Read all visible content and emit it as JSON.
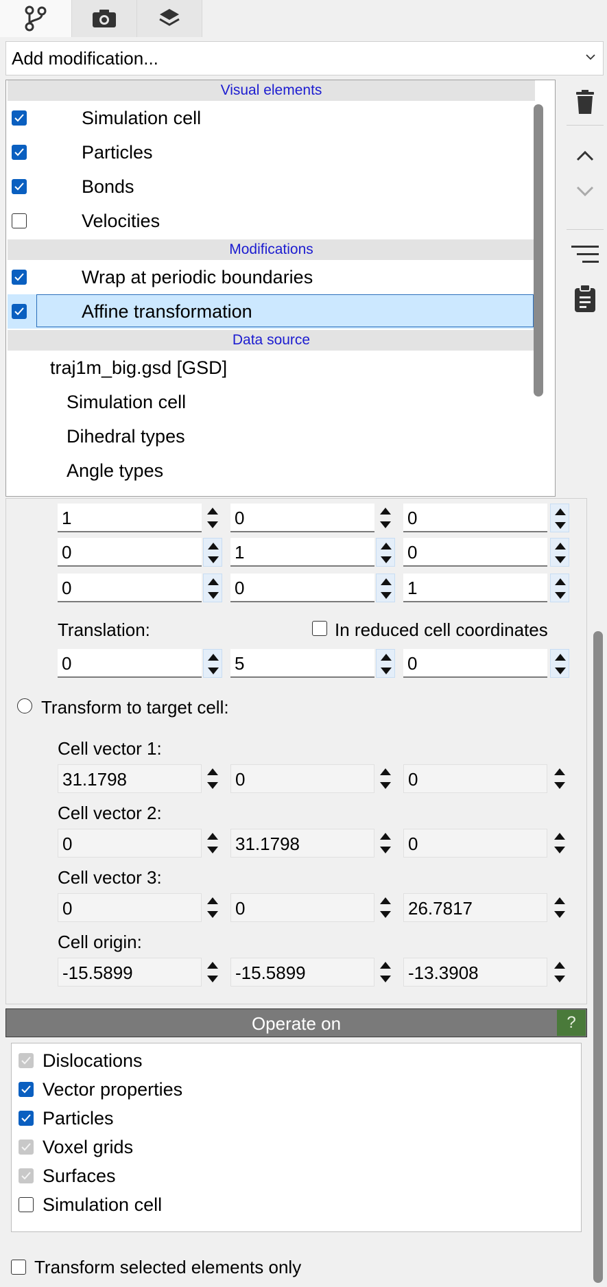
{
  "tabs": [
    {
      "name": "pipeline-tab",
      "icon": "pipeline-branch-icon"
    },
    {
      "name": "render-tab",
      "icon": "camera-icon"
    },
    {
      "name": "overlays-tab",
      "icon": "layers-icon"
    }
  ],
  "add_modification": {
    "label": "Add modification..."
  },
  "pipeline": {
    "visual_header": "Visual elements",
    "visual": [
      {
        "label": "Simulation cell",
        "checked": true
      },
      {
        "label": "Particles",
        "checked": true
      },
      {
        "label": "Bonds",
        "checked": true
      },
      {
        "label": "Velocities",
        "checked": false
      }
    ],
    "mod_header": "Modifications",
    "mods": [
      {
        "label": "Wrap at periodic boundaries",
        "checked": true
      },
      {
        "label": "Affine transformation",
        "checked": true,
        "selected": true
      }
    ],
    "ds_header": "Data source",
    "source": {
      "file": "traj1m_big.gsd [GSD]",
      "children": [
        "Simulation cell",
        "Dihedral types",
        "Angle types"
      ]
    }
  },
  "side_buttons": [
    "delete-icon",
    "move-up-icon",
    "move-down-icon",
    "manage-modifiers-icon",
    "clipboard-icon"
  ],
  "affine": {
    "matrix": [
      [
        "1",
        "0",
        "0"
      ],
      [
        "0",
        "1",
        "0"
      ],
      [
        "0",
        "0",
        "1"
      ]
    ],
    "translation_label": "Translation:",
    "reduced_label": "In reduced cell coordinates",
    "translation": [
      "0",
      "5",
      "0"
    ],
    "target_label": "Transform to target cell:",
    "cell_vector1_label": "Cell vector 1:",
    "cell_vector1": [
      "31.1798",
      "0",
      "0"
    ],
    "cell_vector2_label": "Cell vector 2:",
    "cell_vector2": [
      "0",
      "31.1798",
      "0"
    ],
    "cell_vector3_label": "Cell vector 3:",
    "cell_vector3": [
      "0",
      "0",
      "26.7817"
    ],
    "cell_origin_label": "Cell origin:",
    "cell_origin": [
      "-15.5899",
      "-15.5899",
      "-13.3908"
    ]
  },
  "operate_on": {
    "title": "Operate on",
    "help": "?",
    "items": [
      {
        "label": "Dislocations",
        "state": "disabled"
      },
      {
        "label": "Vector properties",
        "state": "on"
      },
      {
        "label": "Particles",
        "state": "on"
      },
      {
        "label": "Voxel grids",
        "state": "disabled"
      },
      {
        "label": "Surfaces",
        "state": "disabled"
      },
      {
        "label": "Simulation cell",
        "state": "off"
      }
    ]
  },
  "selected_only": {
    "label": "Transform selected elements only",
    "checked": false
  }
}
